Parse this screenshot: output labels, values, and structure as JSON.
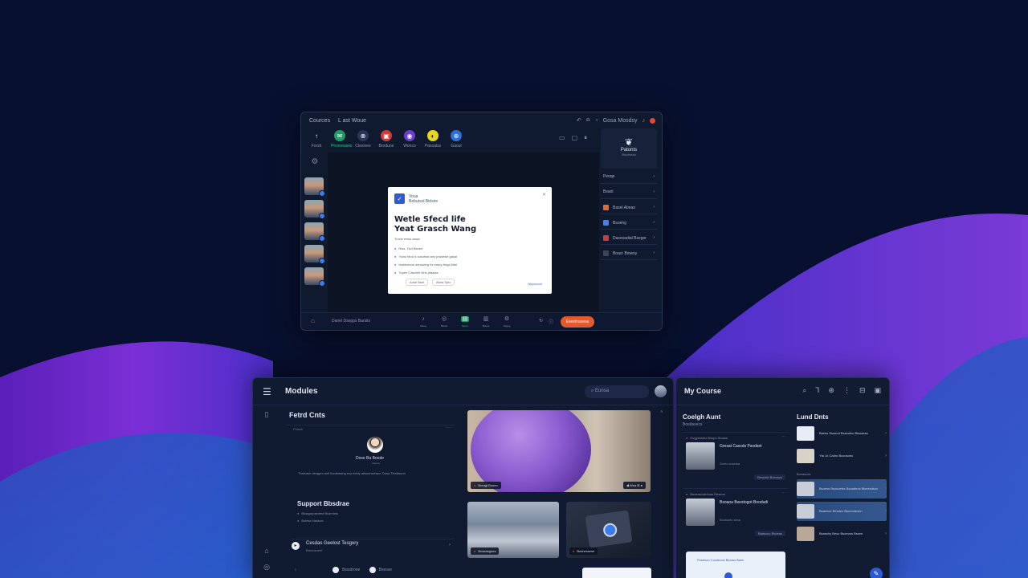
{
  "colors": {
    "bg": "#07102e",
    "wave_purple": "#7b2fd6",
    "wave_blue": "#2f5fd0",
    "accent_green": "#35c98c",
    "end_call": "#e55a2b",
    "record": "#e2473c"
  },
  "call": {
    "title_left": "Cources",
    "title_right": "L ast Woue",
    "top_right_label": "Gosa Mosdsy",
    "apps": [
      {
        "label": "Forsh",
        "icon": "arrow-up-icon",
        "color": "#0f1a2f"
      },
      {
        "label": "Prconouses",
        "icon": "chat-icon",
        "color": "#1f9a66"
      },
      {
        "label": "Ctesivee",
        "icon": "link-icon",
        "color": "#2a3656"
      },
      {
        "label": "Brodune",
        "icon": "square-icon",
        "color": "#d23a3a"
      },
      {
        "label": "Wonco",
        "icon": "circle-icon",
        "color": "#6d3cd6"
      },
      {
        "label": "Pasoalss",
        "icon": "sun-icon",
        "color": "#e8d61e"
      },
      {
        "label": "Gaoul",
        "icon": "globe-icon",
        "color": "#2a6fd6"
      }
    ],
    "document": {
      "brand": "Voua",
      "brand_sub": "Bebutsol Bidsire",
      "heading_line1": "Wetle Sfecd life",
      "heading_line2": "Yeat Grasch Wang",
      "subtext": "Trocis enssi aswa",
      "list": [
        "Hiss. Ticd Bsoed",
        "Yoosi ritoci s sosotwa ans prasesie gasai",
        "Isatdoecoe senowing hs eascy tinga bitel",
        "Topee Casdnet tiins ptaalas"
      ],
      "tags": [
        "Aose Bsel",
        "Abea Spio"
      ],
      "link": "Nitpewonl"
    },
    "right_panel": {
      "card_name": "Patonts",
      "card_sub": "Bisutsesa",
      "rows": [
        {
          "label": "Peoqe",
          "swatch": ""
        },
        {
          "label": "Bsaol",
          "swatch": ""
        },
        {
          "label": "Basel Abeao",
          "swatch": "#e56a2b"
        },
        {
          "label": "Bsoeng",
          "swatch": "#4a7fe0"
        },
        {
          "label": "Dasesadial Bsegor",
          "swatch": "#d23a3a"
        },
        {
          "label": "Boacr Biowsy",
          "swatch": "#3a4660"
        }
      ]
    },
    "footer_name": "Danel Dsepps Barsits",
    "controls": [
      {
        "label": "Sbsoy",
        "icon": "mic-icon"
      },
      {
        "label": "Bloats",
        "icon": "camera-icon"
      },
      {
        "label": "Spnre",
        "icon": "share-icon"
      },
      {
        "label": "Booes",
        "icon": "file-icon"
      },
      {
        "label": "Nagog",
        "icon": "settings-icon"
      }
    ],
    "end_label": "Exestnsoesa"
  },
  "modules": {
    "title": "Modules",
    "search_placeholder": "Eunsa",
    "featured_title": "Fetrd Cnts",
    "featured_tiny": "Poissh",
    "featured_person": "Dose Ba Boode",
    "featured_person_sub": "Aoeoco",
    "featured_desc": "Thsiease desgprs antl fucdeastng evy ettcly atlsuonweswr. Dosa Tieridsoon",
    "support_title": "Support Bbsdrae",
    "support_list": [
      "Btoagoposntest Bsoreisto",
      "Bolesa Vaalcce"
    ],
    "course_row_title": "Cesdas Geelost Tesgory",
    "course_row_sub": "Bresosoeet",
    "pager_prev": "Bssstrone",
    "pager_next": "Bsesse",
    "thumbs": [
      {
        "caption": "Breagl Boueo"
      },
      {
        "caption": "Bnseasgoes"
      },
      {
        "caption": "Beshessese"
      }
    ],
    "thumb1_controls": "Wsa"
  },
  "course": {
    "title": "My Course",
    "col1_title": "Coelgh Aunt",
    "col1_sub": "Bosdasecs",
    "lessons": [
      {
        "tag": "Gvgysssteo Bsspo Stoass",
        "name": "Gresat Cassds Psodset",
        "desc": "Snmo scsetsa",
        "btn": "Bessote Boeoscs"
      },
      {
        "tag": "Bsceasooedoao Reseos",
        "name": "Bsoaoa Bsestogot Boodudi",
        "desc": "Bcosseto sesa",
        "btn": "Baasoco Bsoeas"
      }
    ],
    "promo_text": "Posesoo Cocdnoce Biooso Bses",
    "col2_title": "Lund Dnts",
    "col2_items": [
      {
        "text": "Baess Ssoeod Bsseotso Biosaess",
        "logo": "#e8ecf6",
        "selected": false
      },
      {
        "text": "Yta Jo Cadro Bcoosoeo",
        "logo": "#d8d2c8",
        "selected": false
      }
    ],
    "col2_section": "Bosascos",
    "col2_items2": [
      {
        "text": "Bsoess Bsosoetss Bsoadeos Biseesdsoc",
        "logo": "#c7ccd6",
        "selected": true
      },
      {
        "text": "Bsaesoe Besdeo Bsooodesnn",
        "logo": "#c7ccd6",
        "selected": true
      },
      {
        "text": "Bsasshy Beso Bsoeoos Bssee",
        "logo": "#b9a79a",
        "selected": false
      }
    ]
  }
}
